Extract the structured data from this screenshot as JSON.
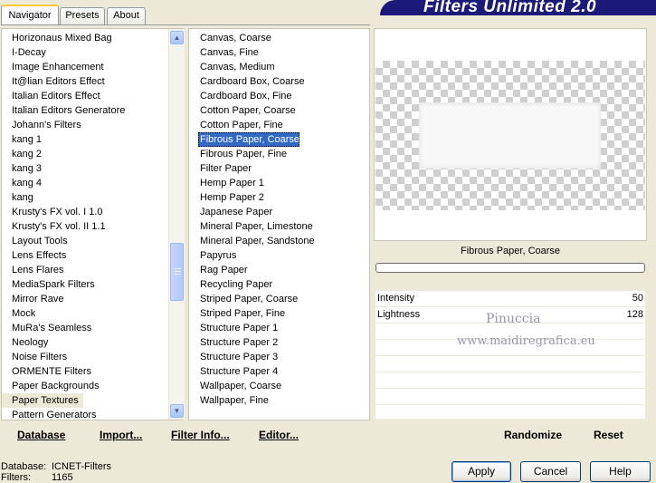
{
  "app": {
    "title": "Filters Unlimited 2.0"
  },
  "tabs": [
    {
      "label": "Navigator"
    },
    {
      "label": "Presets"
    },
    {
      "label": "About"
    }
  ],
  "categories": {
    "selected_index": 25,
    "items": [
      "Horizonaus Mixed Bag",
      "I-Decay",
      "Image Enhancement",
      "It@lian Editors Effect",
      "Italian Editors Effect",
      "Italian Editors Generatore",
      "Johann's Filters",
      "kang 1",
      "kang 2",
      "kang 3",
      "kang 4",
      "kang",
      "Krusty's FX vol. I 1.0",
      "Krusty's FX vol. II 1.1",
      "Layout Tools",
      "Lens Effects",
      "Lens Flares",
      "MediaSpark Filters",
      "Mirror Rave",
      "Mock",
      "MuRa's Seamless",
      "Neology",
      "Noise Filters",
      "ORMENTE Filters",
      "Paper Backgrounds",
      "Paper Textures",
      "Pattern Generators"
    ]
  },
  "filters": {
    "selected_index": 7,
    "items": [
      "Canvas, Coarse",
      "Canvas, Fine",
      "Canvas, Medium",
      "Cardboard Box, Coarse",
      "Cardboard Box, Fine",
      "Cotton Paper, Coarse",
      "Cotton Paper, Fine",
      "Fibrous Paper, Coarse",
      "Fibrous Paper, Fine",
      "Filter Paper",
      "Hemp Paper 1",
      "Hemp Paper 2",
      "Japanese Paper",
      "Mineral Paper, Limestone",
      "Mineral Paper, Sandstone",
      "Papyrus",
      "Rag Paper",
      "Recycling Paper",
      "Striped Paper, Coarse",
      "Striped Paper, Fine",
      "Structure Paper 1",
      "Structure Paper 2",
      "Structure Paper 3",
      "Structure Paper 4",
      "Wallpaper, Coarse",
      "Wallpaper, Fine"
    ]
  },
  "preview": {
    "filter_name": "Fibrous Paper, Coarse"
  },
  "params": [
    {
      "label": "Intensity",
      "value": "50"
    },
    {
      "label": "Lightness",
      "value": "128"
    }
  ],
  "watermark": {
    "line1": "Pinuccia",
    "line2": "www.maidiregrafica.eu"
  },
  "bottom_links": {
    "database": "Database",
    "import": "Import...",
    "filter_info": "Filter Info...",
    "editor": "Editor...",
    "randomize": "Randomize",
    "reset": "Reset"
  },
  "status": {
    "database_label": "Database:",
    "database_value": "ICNET-Filters",
    "filters_label": "Filters:",
    "filters_value": "1165"
  },
  "buttons": {
    "apply": "Apply",
    "cancel": "Cancel",
    "help": "Help"
  }
}
